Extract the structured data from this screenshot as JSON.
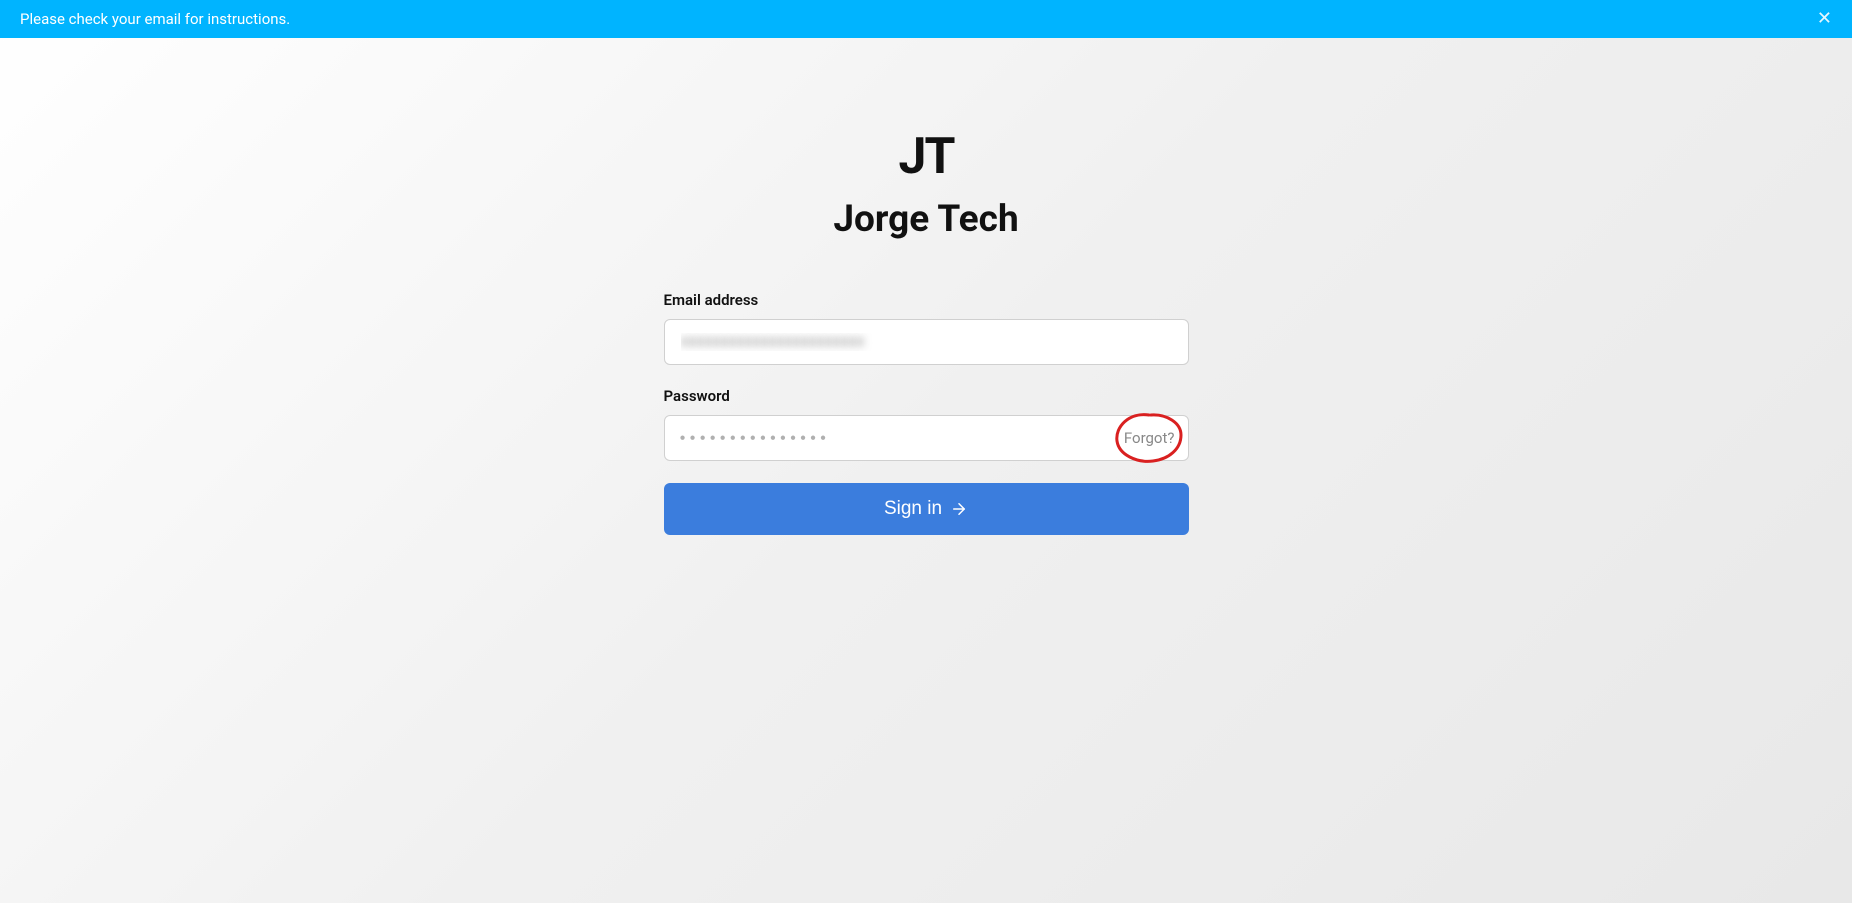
{
  "notification": {
    "message": "Please check your email for instructions.",
    "close_label": "✕"
  },
  "brand": {
    "logo_text": "JT",
    "name": "Jorge Tech"
  },
  "form": {
    "email_label": "Email address",
    "email_value": "",
    "password_label": "Password",
    "password_dots": "●●●●●●●●●●●●●●●",
    "forgot_label": "Forgot?",
    "signin_label": "Sign in"
  },
  "colors": {
    "notification_bg": "#00b4ff",
    "button_bg": "#3b7ddd",
    "annotation": "#d92020"
  }
}
